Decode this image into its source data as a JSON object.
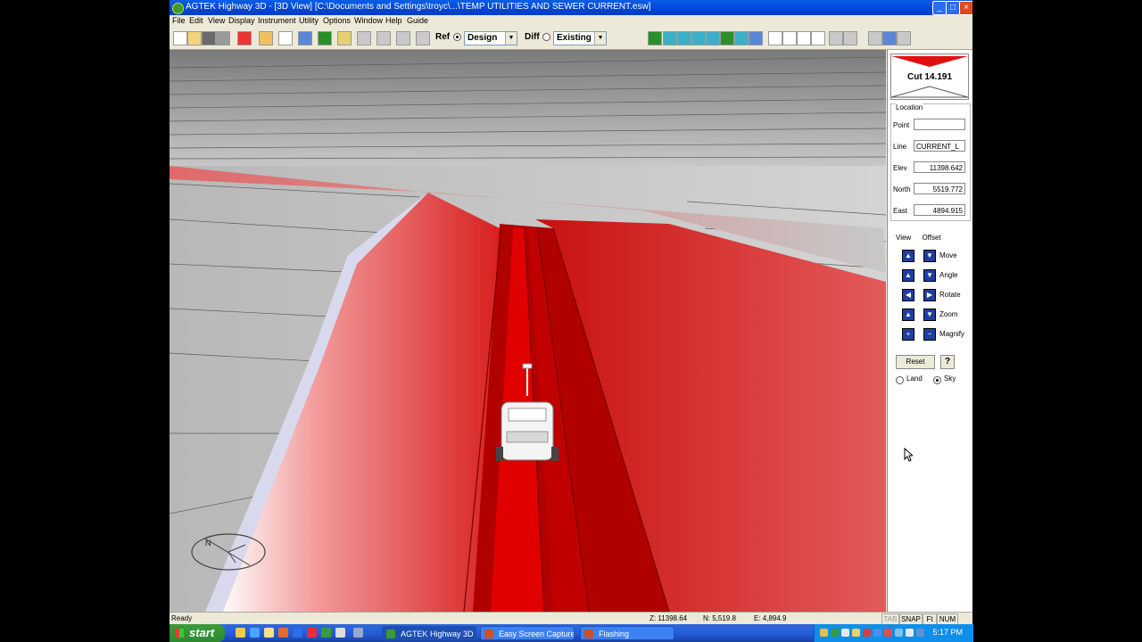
{
  "window": {
    "title": "AGTEK Highway 3D - [3D View]  [C:\\Documents and Settings\\troyc\\...\\TEMP UTILITIES AND SEWER CURRENT.esw]",
    "minimize": "_",
    "maximize": "□",
    "close": "×"
  },
  "menu": [
    "File",
    "Edit",
    "View",
    "Display",
    "Instrument",
    "Utility",
    "Options",
    "Window",
    "Help",
    "Guide"
  ],
  "toolbar": {
    "ref_label": "Ref",
    "ref_value": "Design",
    "diff_label": "Diff",
    "diff_value": "Existing"
  },
  "panel": {
    "cut_label": "Cut 14.191",
    "location_title": "Location",
    "point_label": "Point",
    "point_value": "",
    "line_label": "Line",
    "line_value": "CURRENT_L",
    "elev_label": "Elev",
    "elev_value": "11398.642",
    "north_label": "North",
    "north_value": "5519.772",
    "east_label": "East",
    "east_value": "4894.915",
    "tab_view": "View",
    "tab_offset": "Offset",
    "move": "Move",
    "angle": "Angle",
    "rotate": "Rotate",
    "zoom": "Zoom",
    "magnify": "Magnify",
    "reset": "Reset",
    "help": "?",
    "land": "Land",
    "sky": "Sky"
  },
  "compass": {
    "north_marker": "N"
  },
  "status": {
    "ready": "Ready",
    "z": "Z: 11398.64",
    "n": "N: 5,519.8",
    "e": "E: 4,894.9",
    "tab": "TAB",
    "snap": "SNAP",
    "ft": "Ft",
    "num": "NUM"
  },
  "taskbar": {
    "start": "start",
    "tasks": [
      "AGTEK Highway 3D - ...",
      "Easy Screen Capture ...",
      "Flashing"
    ],
    "clock": "5:17 PM"
  }
}
